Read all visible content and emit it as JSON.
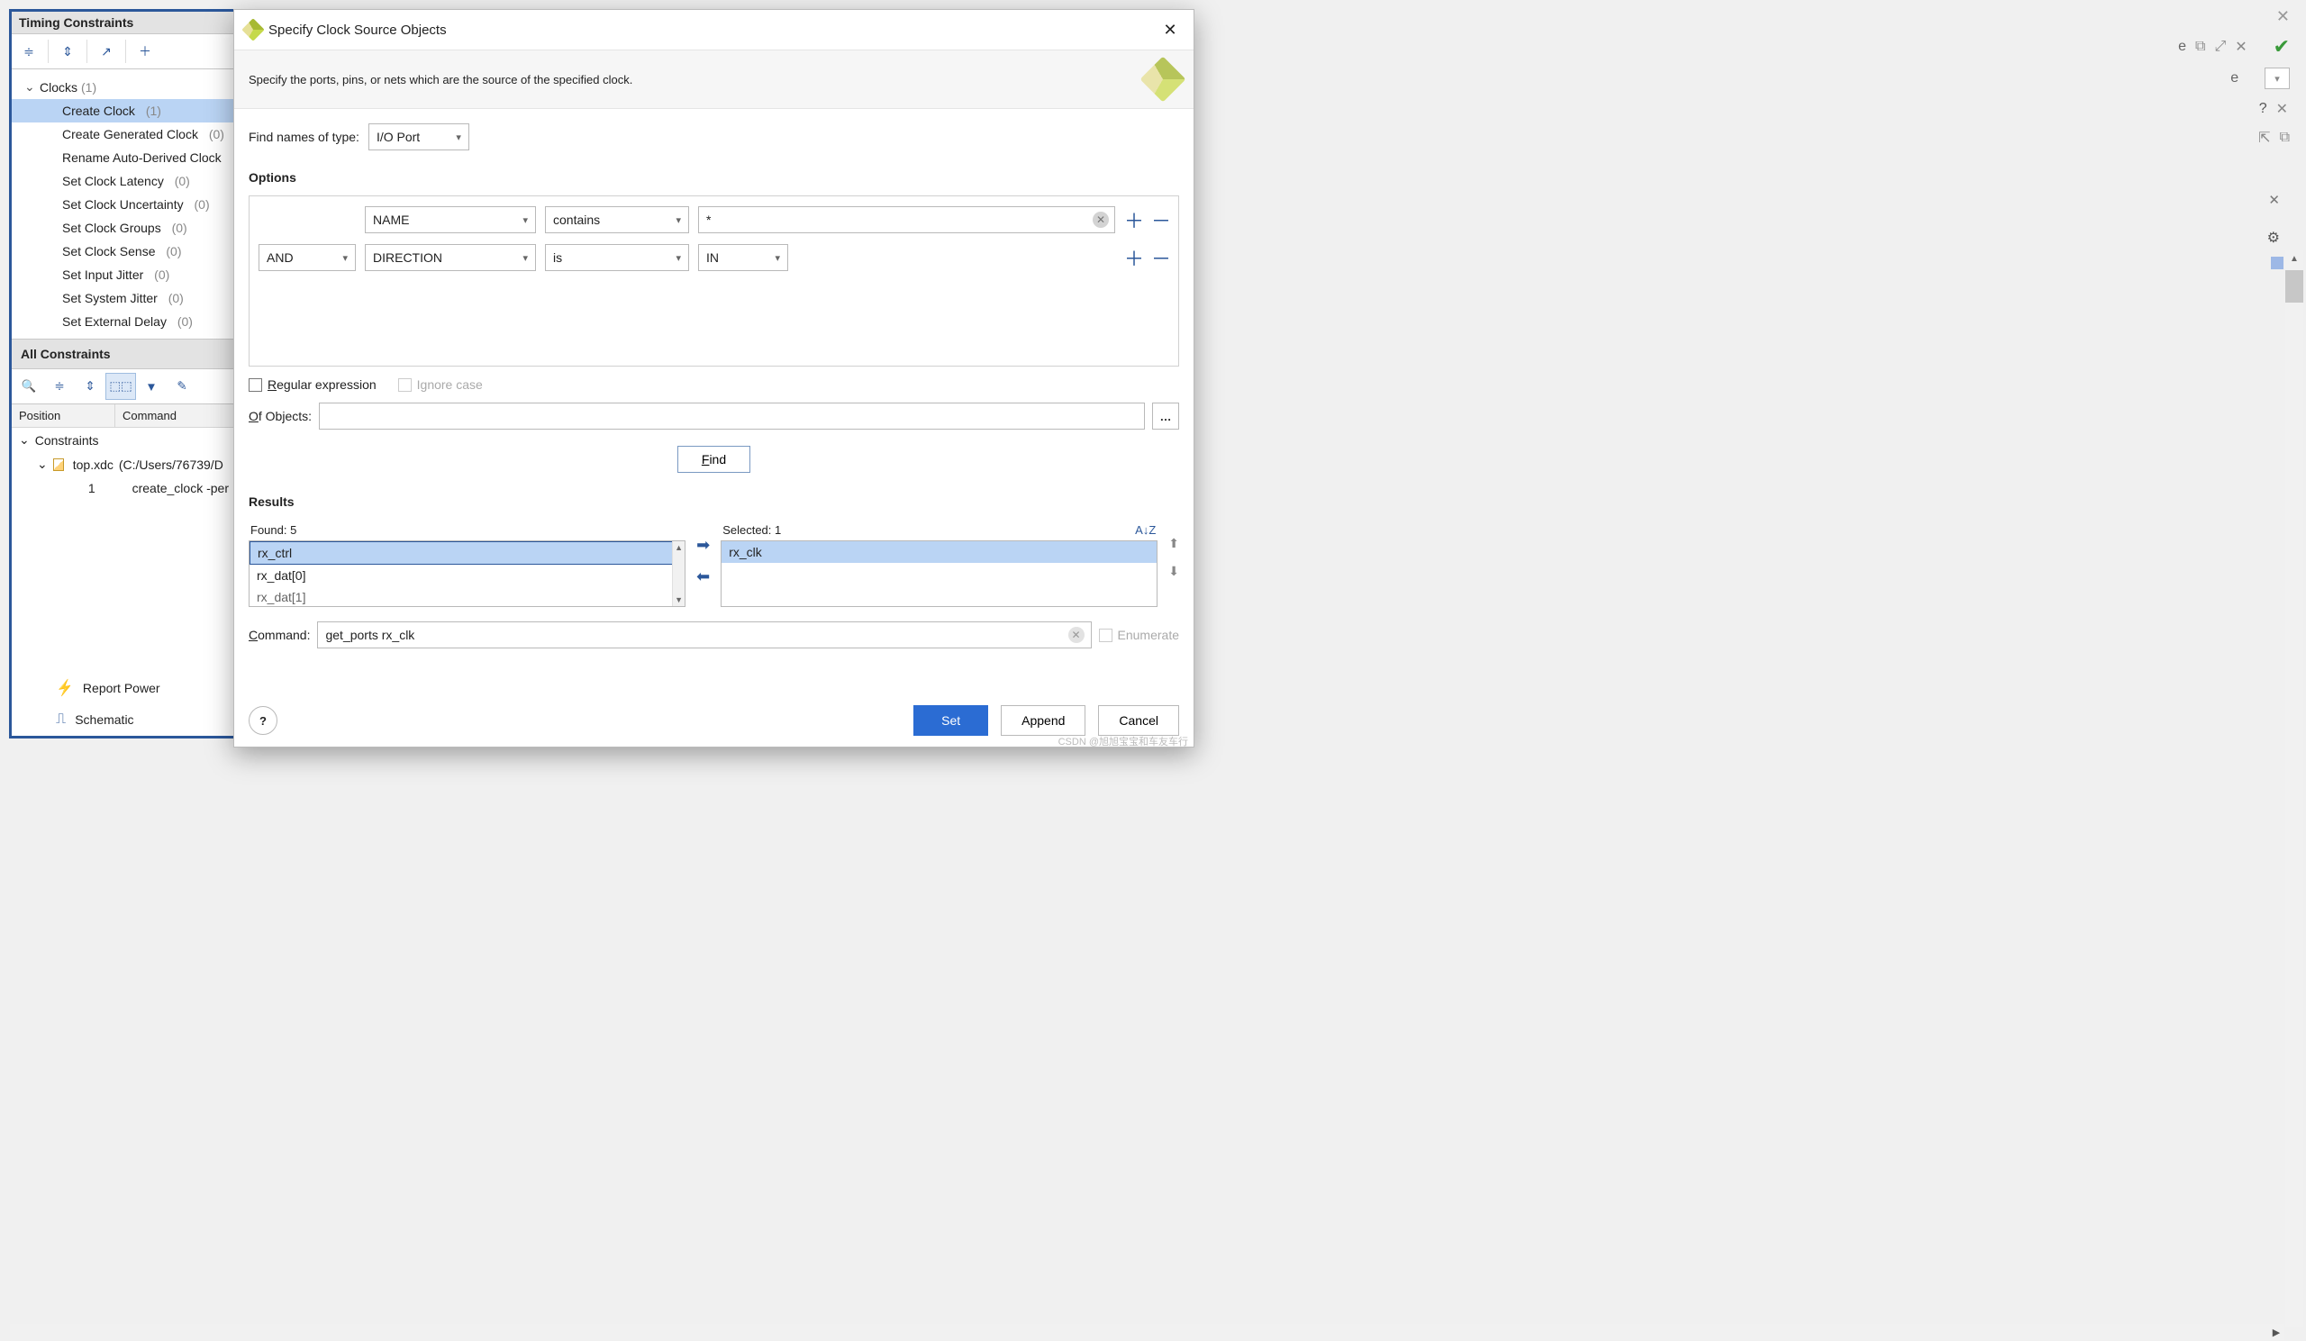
{
  "left_panel": {
    "title": "Timing Constraints",
    "tree": {
      "clocks_label": "Clocks",
      "clocks_count": "(1)",
      "items": [
        {
          "label": "Create Clock",
          "count": "(1)",
          "selected": true
        },
        {
          "label": "Create Generated Clock",
          "count": "(0)"
        },
        {
          "label": "Rename Auto-Derived Clock"
        },
        {
          "label": "Set Clock Latency",
          "count": "(0)"
        },
        {
          "label": "Set Clock Uncertainty",
          "count": "(0)"
        },
        {
          "label": "Set Clock Groups",
          "count": "(0)"
        },
        {
          "label": "Set Clock Sense",
          "count": "(0)"
        },
        {
          "label": "Set Input Jitter",
          "count": "(0)"
        },
        {
          "label": "Set System Jitter",
          "count": "(0)"
        },
        {
          "label": "Set External Delay",
          "count": "(0)"
        }
      ]
    },
    "all_constraints_header": "All Constraints",
    "grid_headers": {
      "pos": "Position",
      "cmd": "Command"
    },
    "constraints_label": "Constraints",
    "xdc_file": "top.xdc",
    "xdc_path": "(C:/Users/76739/D",
    "row_pos": "1",
    "row_cmd": "create_clock -per"
  },
  "bottom_links": {
    "report_power": "Report Power",
    "schematic": "Schematic"
  },
  "dialog": {
    "title": "Specify Clock Source Objects",
    "banner": "Specify the ports, pins, or nets which are the source of the specified clock.",
    "find_type_label": "Find names of type:",
    "find_type_value": "I/O Port",
    "options_header": "Options",
    "opt_row1": {
      "field": "NAME",
      "op": "contains",
      "val": "*"
    },
    "opt_row2": {
      "logic": "AND",
      "field": "DIRECTION",
      "op": "is",
      "val": "IN"
    },
    "regex_label": "Regular expression",
    "regex_underline": "R",
    "ignore_case": "Ignore case",
    "of_objects_label": "Of Objects:",
    "of_underline": "O",
    "find_btn": "Find",
    "find_underline": "F",
    "results_header": "Results",
    "found_label": "Found: 5",
    "selected_label": "Selected: 1",
    "sort_label": "A↓Z",
    "found_items": [
      "rx_ctrl",
      "rx_dat[0]",
      "rx_dat[1]"
    ],
    "selected_items": [
      "rx_clk"
    ],
    "command_label": "Command:",
    "command_underline": "C",
    "command_value": "get_ports rx_clk",
    "enumerate": "Enumerate",
    "set_btn": "Set",
    "append_btn": "Append",
    "cancel_btn": "Cancel",
    "watermark": "CSDN @旭旭宝宝和车友车行"
  }
}
